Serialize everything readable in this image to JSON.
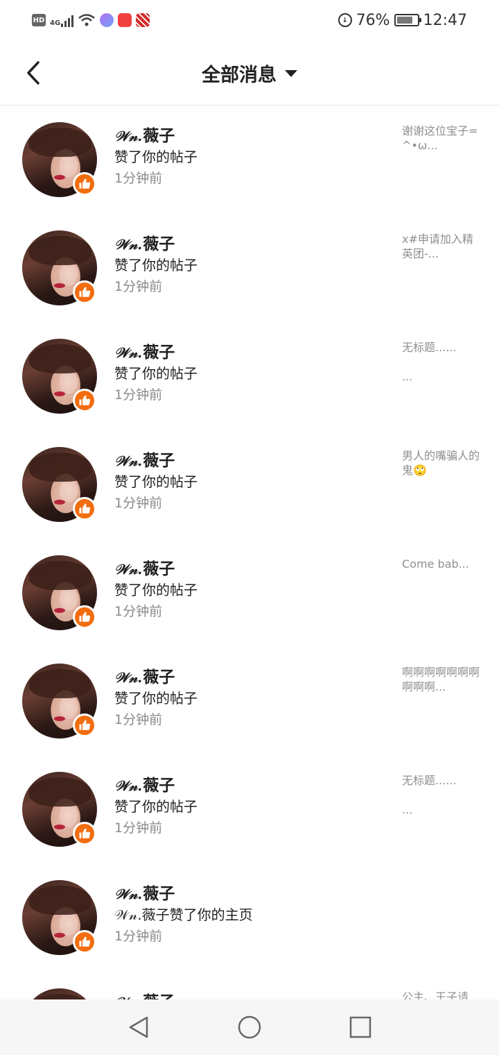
{
  "status_bar": {
    "hd": "HD",
    "network": "4G",
    "battery_percent": "76%",
    "battery_level": 0.76,
    "time": "12:47",
    "icons": [
      "hd-icon",
      "signal-icon",
      "wifi-icon",
      "music-icon",
      "toutiao-icon",
      "app-icon",
      "data-saver-icon",
      "battery-icon"
    ]
  },
  "header": {
    "title": "全部消息"
  },
  "colors": {
    "badge": "#f26d0f",
    "title": "#222222",
    "secondary": "#8a8a8a"
  },
  "messages": [
    {
      "user_deco": "𝒲𝓃.",
      "user_name": "薇子",
      "action": "赞了你的帖子",
      "time": "1分钟前",
      "preview": "谢谢这位宝子=^•ω..."
    },
    {
      "user_deco": "𝒲𝓃.",
      "user_name": "薇子",
      "action": "赞了你的帖子",
      "time": "1分钟前",
      "preview": "x#申请加入精英团-..."
    },
    {
      "user_deco": "𝒲𝓃.",
      "user_name": "薇子",
      "action": "赞了你的帖子",
      "time": "1分钟前",
      "preview": "无标题......\n\n..."
    },
    {
      "user_deco": "𝒲𝓃.",
      "user_name": "薇子",
      "action": "赞了你的帖子",
      "time": "1分钟前",
      "preview": "男人的嘴骗人的鬼🙄"
    },
    {
      "user_deco": "𝒲𝓃.",
      "user_name": "薇子",
      "action": "赞了你的帖子",
      "time": "1分钟前",
      "preview": "Come   bab..."
    },
    {
      "user_deco": "𝒲𝓃.",
      "user_name": "薇子",
      "action": "赞了你的帖子",
      "time": "1分钟前",
      "preview": "啊啊啊啊啊啊啊啊啊啊..."
    },
    {
      "user_deco": "𝒲𝓃.",
      "user_name": "薇子",
      "action": "赞了你的帖子",
      "time": "1分钟前",
      "preview": "无标题......\n\n..."
    },
    {
      "user_deco": "𝒲𝓃.",
      "user_name": "薇子",
      "action": "𝒲𝓃.薇子赞了你的主页",
      "time": "1分钟前",
      "preview": ""
    },
    {
      "user_deco": "𝒲𝓃.",
      "user_name": "薇子",
      "action": "",
      "time": "",
      "preview": "公主、王子请"
    }
  ]
}
